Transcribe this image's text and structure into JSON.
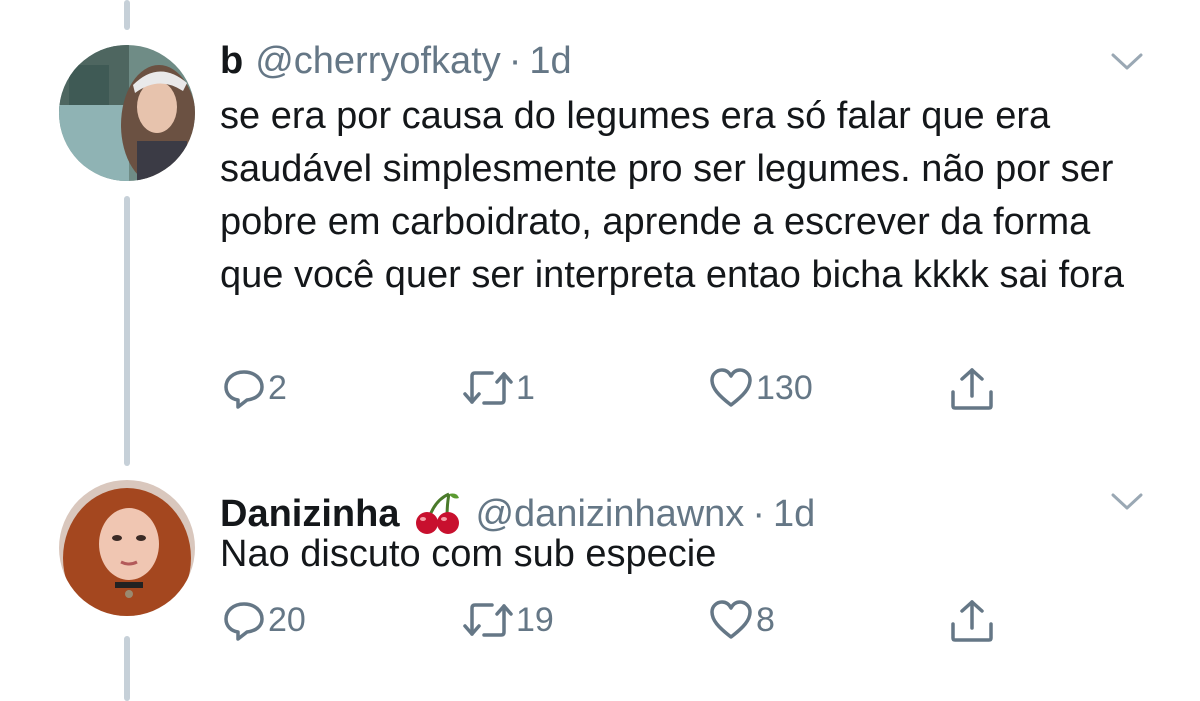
{
  "tweets": [
    {
      "name": "b",
      "handle": "@cherryofkaty",
      "separator": "·",
      "time": "1d",
      "text": "se era por causa do legumes era só falar que era saudável simplesmente pro ser legumes. não por ser pobre em carboidrato, aprende a escrever da forma que você quer ser interpreta entao bicha kkkk sai fora",
      "replies": "2",
      "retweets": "1",
      "likes": "130"
    },
    {
      "name": "Danizinha",
      "handle": "@danizinhawnx",
      "separator": "·",
      "time": "1d",
      "text": "Nao discuto com sub especie",
      "replies": "20",
      "retweets": "19",
      "likes": "8",
      "name_emoji": "cherry-emoji"
    }
  ],
  "colors": {
    "text": "#14171a",
    "secondary": "#657786",
    "thread_line": "#c6d0d8",
    "background": "#ffffff"
  }
}
